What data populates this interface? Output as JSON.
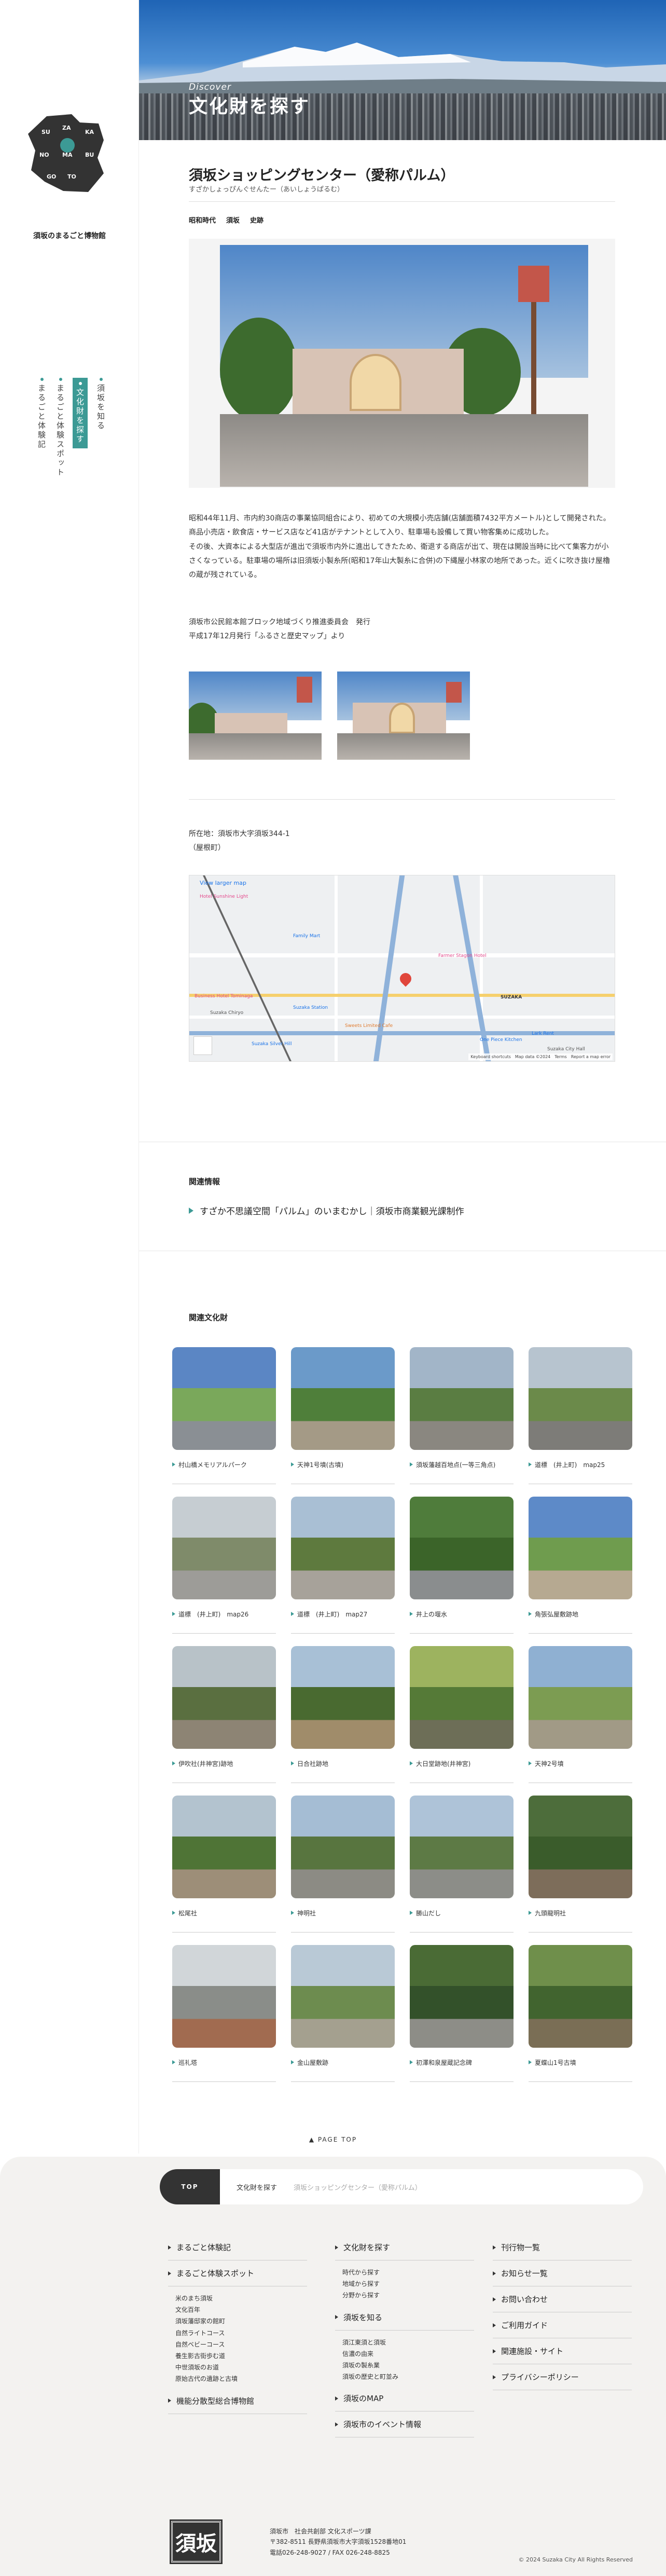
{
  "sidebar": {
    "regions": [
      "SU",
      "ZA",
      "KA",
      "NO",
      "MA",
      "BU",
      "GO",
      "TO"
    ],
    "site_title": "須坂のまるごと博物館",
    "nav": [
      {
        "label": "須坂を知る",
        "active": false
      },
      {
        "label": "文化財を探す",
        "active": true
      },
      {
        "label": "まるごと体験スポット",
        "active": false
      },
      {
        "label": "まるごと体験記",
        "active": false
      }
    ]
  },
  "hero": {
    "eyebrow": "Discover",
    "title": "文化財を探す"
  },
  "article": {
    "title": "須坂ショッピングセンター（愛称パルム）",
    "kana": "すざかしょっぴんぐせんたー（あいしょうぱるむ）",
    "tags": [
      "昭和時代",
      "須坂",
      "史跡"
    ],
    "body": [
      "昭和44年11月、市内約30商店の事業協同組合により、初めての大規模小売店舗(店舗面積7432平方メートル)として開発された。商品小売店・飲食店・サービス店など41店がテナントとして入り、駐車場も設備して買い物客集めに成功した。",
      "その後、大資本による大型店が進出で須坂市内外に進出してきたため、衛退する商店が出て、現在は開設当時に比べて集客力が小さくなっている。駐車場の場所は旧須坂小製糸所(昭和17年山大製糸に合併)の下縄屋小林家の地所であった。近くに吹き抜け屋櫓の蔵が残されている。"
    ],
    "credit": [
      "須坂市公民館本館ブロック地域づくり推進委員会　発行",
      "平成17年12月発行「ふるさと歴史マップ」より"
    ],
    "address": [
      "所在地：須坂市大字須坂344-1",
      "（屋根町）"
    ]
  },
  "map": {
    "view_link": "View larger map",
    "attribution": "Keyboard shortcuts　Map data ©2024　Terms　Report a map error",
    "labels": [
      "Hotel Sunshine Light",
      "Family Mart",
      "Farmer Stagon Hotel",
      "SUZAKA",
      "Suzaka Station",
      "Suzaka Silver Hill",
      "Suzaka City Hall",
      "Lark Rent",
      "Business Hotel Tominaga",
      "Suzaka Chiryo",
      "Sweets Limited Cafe",
      "One Piece Kitchen"
    ]
  },
  "related_info": {
    "heading": "関連情報",
    "link": "すざか不思議空間「パルム」のいまむかし｜須坂市商業観光課制作"
  },
  "related_assets": {
    "heading": "関連文化財",
    "items": [
      "村山橋メモリアルパーク",
      "天神1号墳(古墳)",
      "須坂藩越百地点(一等三角点)",
      "道標　(井上町)　map25",
      "道標　(井上町)　map26",
      "道標　(井上町)　map27",
      "井上の堰水",
      "角張弘屋敷跡地",
      "伊吹社(井神宮)跡地",
      "日合社跡地",
      "大日堂跡地(井神宮)",
      "天神2号墳",
      "松尾社",
      "神明社",
      "勝山だし",
      "九頭龍明社",
      "巡礼塔",
      "金山屋敷跡",
      "初澤和泉屋蔵記念碑",
      "夏蝶山1号古墳"
    ]
  },
  "pagetop": "▲  PAGE TOP",
  "breadcrumb": {
    "top": "TOP",
    "level1": "文化財を探す",
    "current": "須坂ショッピングセンター（愛称パルム）"
  },
  "footer": {
    "col1": [
      {
        "head": "まるごと体験記",
        "subs": []
      },
      {
        "head": "まるごと体験スポット",
        "subs": [
          "米のまち須坂",
          "文化百年",
          "須坂藩邸家の館町",
          "自然ライトコース",
          "自然ベビーコース",
          "養生影古街歩む道",
          "中世須坂のお道",
          "原始古代の遺跡と古墳"
        ]
      },
      {
        "head": "機能分散型総合博物館",
        "subs": []
      }
    ],
    "col2": [
      {
        "head": "文化財を探す",
        "subs": [
          "時代から探す",
          "地域から探す",
          "分野から探す"
        ]
      },
      {
        "head": "須坂を知る",
        "subs": [
          "須江東須と須坂",
          "信濃の由来",
          "須坂の製糸業",
          "須坂の歴史と町並み"
        ]
      },
      {
        "head": "須坂のMAP",
        "subs": []
      },
      {
        "head": "須坂市のイベント情報",
        "subs": []
      }
    ],
    "col3": [
      {
        "head": "刊行物一覧",
        "subs": []
      },
      {
        "head": "お知らせ一覧",
        "subs": []
      },
      {
        "head": "お問い合わせ",
        "subs": []
      },
      {
        "head": "ご利用ガイド",
        "subs": []
      },
      {
        "head": "関連施設・サイト",
        "subs": []
      },
      {
        "head": "プライバシーポリシー",
        "subs": []
      }
    ],
    "logo_text": "須坂",
    "address": [
      "須坂市　社会共創部 文化スポーツ課",
      "〒382-8511 長野県須坂市大字須坂1528番地01",
      "電話026-248-9027 / FAX 026-248-8825"
    ],
    "copyright": "© 2024 Suzaka City All Rights Reserved"
  },
  "colors": {
    "accent": "#3c9a95",
    "dark": "#333333",
    "footer_bg": "#f3f2f0"
  }
}
